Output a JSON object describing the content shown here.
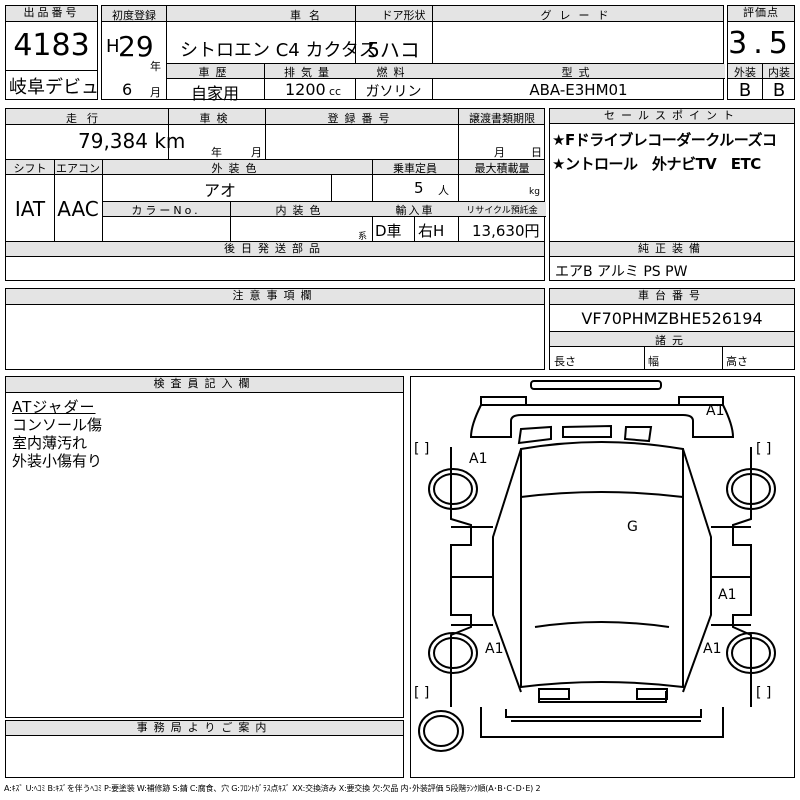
{
  "top": {
    "lot_label": "出品番号",
    "lot_number": "4183",
    "debut_label": "岐阜デビュ",
    "first_reg_label": "初度登録",
    "era": "H",
    "year": "29",
    "year_unit": "年",
    "month": "6",
    "month_unit": "月",
    "name_label": "車名",
    "car_name": "シトロエン C4 カクタス",
    "door_label": "ドア形状",
    "door": "5ハコ",
    "grade_label": "グレード",
    "grade": "",
    "score_label": "評価点",
    "score": "3.5",
    "history_label": "車歴",
    "history": "自家用",
    "disp_label": "排気量",
    "displacement": "1200",
    "disp_unit": "cc",
    "fuel_label": "燃料",
    "fuel": "ガソリン",
    "model_label": "型式",
    "model": "ABA-E3HM01",
    "ext_label": "外装",
    "ext_grade": "B",
    "int_label": "内装",
    "int_grade": "B"
  },
  "mid": {
    "mileage_label": "走行",
    "mileage": "79,384 km",
    "inspection_label": "車検",
    "insp_year_unit": "年",
    "insp_month_unit": "月",
    "reg_label": "登録番号",
    "transfer_label": "譲渡書類期限",
    "transfer_month_unit": "月",
    "transfer_day_unit": "日",
    "shift_label": "シフト",
    "shift": "IAT",
    "ac_label": "エアコン",
    "ac": "AAC",
    "color_label": "外装色",
    "color": "アオ",
    "capacity_label": "乗車定員",
    "capacity": "5",
    "capacity_unit": "人",
    "load_label": "最大積載量",
    "load_unit": "kg",
    "color_no_label": "カラーNo.",
    "int_color_label": "内装色",
    "int_color_suffix": "系",
    "import_label": "輸入車",
    "import_d": "D車",
    "import_h": "右H",
    "recycle_label": "リサイクル預託金",
    "recycle": "13,630円",
    "later_label": "後日発送部品",
    "sales_label": "セールスポイント",
    "sales_line1": "★Fドライブレコーダークルーズコ",
    "sales_line2": "★ントロール　外ナビTV　ETC",
    "equip_label": "純正装備",
    "equip": "エアB アルミ PS PW"
  },
  "notes": {
    "caution_label": "注意事項欄",
    "chassis_label": "車台番号",
    "chassis": "VF70PHMZBHE526194",
    "dims_label": "諸元",
    "length_label": "長さ",
    "width_label": "幅",
    "height_label": "高さ"
  },
  "inspector": {
    "label": "検査員記入欄",
    "lines": [
      "ATジャダー",
      "コンソール傷",
      "室内薄汚れ",
      "外装小傷有り"
    ],
    "office_label": "事務局よりご案内"
  },
  "diagram": {
    "marks": [
      "A1",
      "A1",
      "G",
      "A1",
      "A1",
      "A1"
    ],
    "bracket": "[ ]"
  },
  "legend": "A:ｷｽﾞ U:ﾍｺﾐ B:ｷｽﾞを伴うﾍｺﾐ P:要塗装 W:補修跡 S:錆 C:腐食、穴 G:ﾌﾛﾝﾄｶﾞﾗｽ点ｷｽﾞ XX:交換済み X:要交換 欠:欠品 内･外装評価 5段階ﾗﾝｸ順(A･B･C･D･E) 2"
}
